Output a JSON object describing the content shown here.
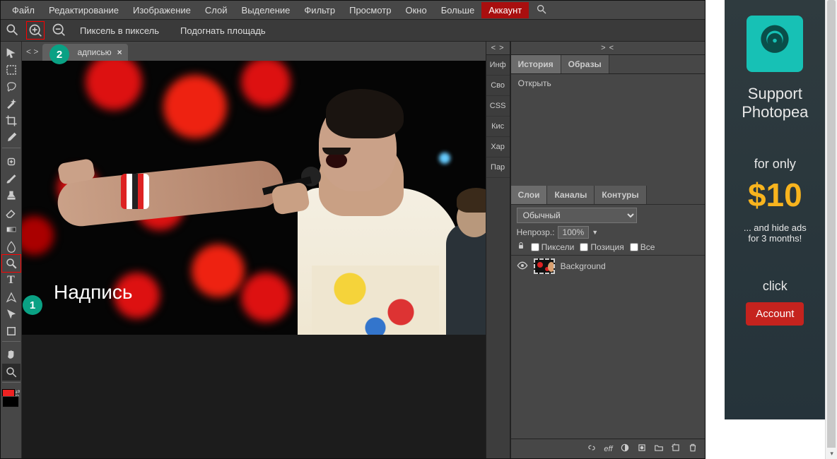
{
  "menubar": {
    "items": [
      "Файл",
      "Редактирование",
      "Изображение",
      "Слой",
      "Выделение",
      "Фильтр",
      "Просмотр",
      "Окно",
      "Больше"
    ],
    "account": "Аккаунт"
  },
  "optbar": {
    "pixel_to_pixel": "Пиксель в пиксель",
    "fit_area": "Подогнать площадь"
  },
  "doc_tab": {
    "title": "Фо       адписью",
    "close": "×"
  },
  "tabbar_chevrons": "< >",
  "canvas_text": "Надпись",
  "vert_strip": {
    "chev": "< >",
    "items": [
      "Инф",
      "Сво",
      "CSS",
      "Кис",
      "Хар",
      "Пар"
    ]
  },
  "panels": {
    "chev": "> <",
    "history_tabs": {
      "history": "История",
      "samples": "Образы"
    },
    "history_item": "Открыть",
    "layers_tabs": {
      "layers": "Слои",
      "channels": "Каналы",
      "paths": "Контуры"
    },
    "blend_mode": "Обычный",
    "opacity_label": "Непрозр.:",
    "opacity_value": "100%",
    "lock_pixels": "Пиксели",
    "lock_position": "Позиция",
    "lock_all": "Все",
    "layer_name": "Background",
    "footer_eff": "eff"
  },
  "ad": {
    "line1": "Support",
    "line2": "Photopea",
    "for_only": "for only",
    "price": "$10",
    "hide1": "... and hide ads",
    "hide2": "for 3 months!",
    "click": "click",
    "button": "Account"
  },
  "annotations": {
    "one": "1",
    "two": "2"
  }
}
